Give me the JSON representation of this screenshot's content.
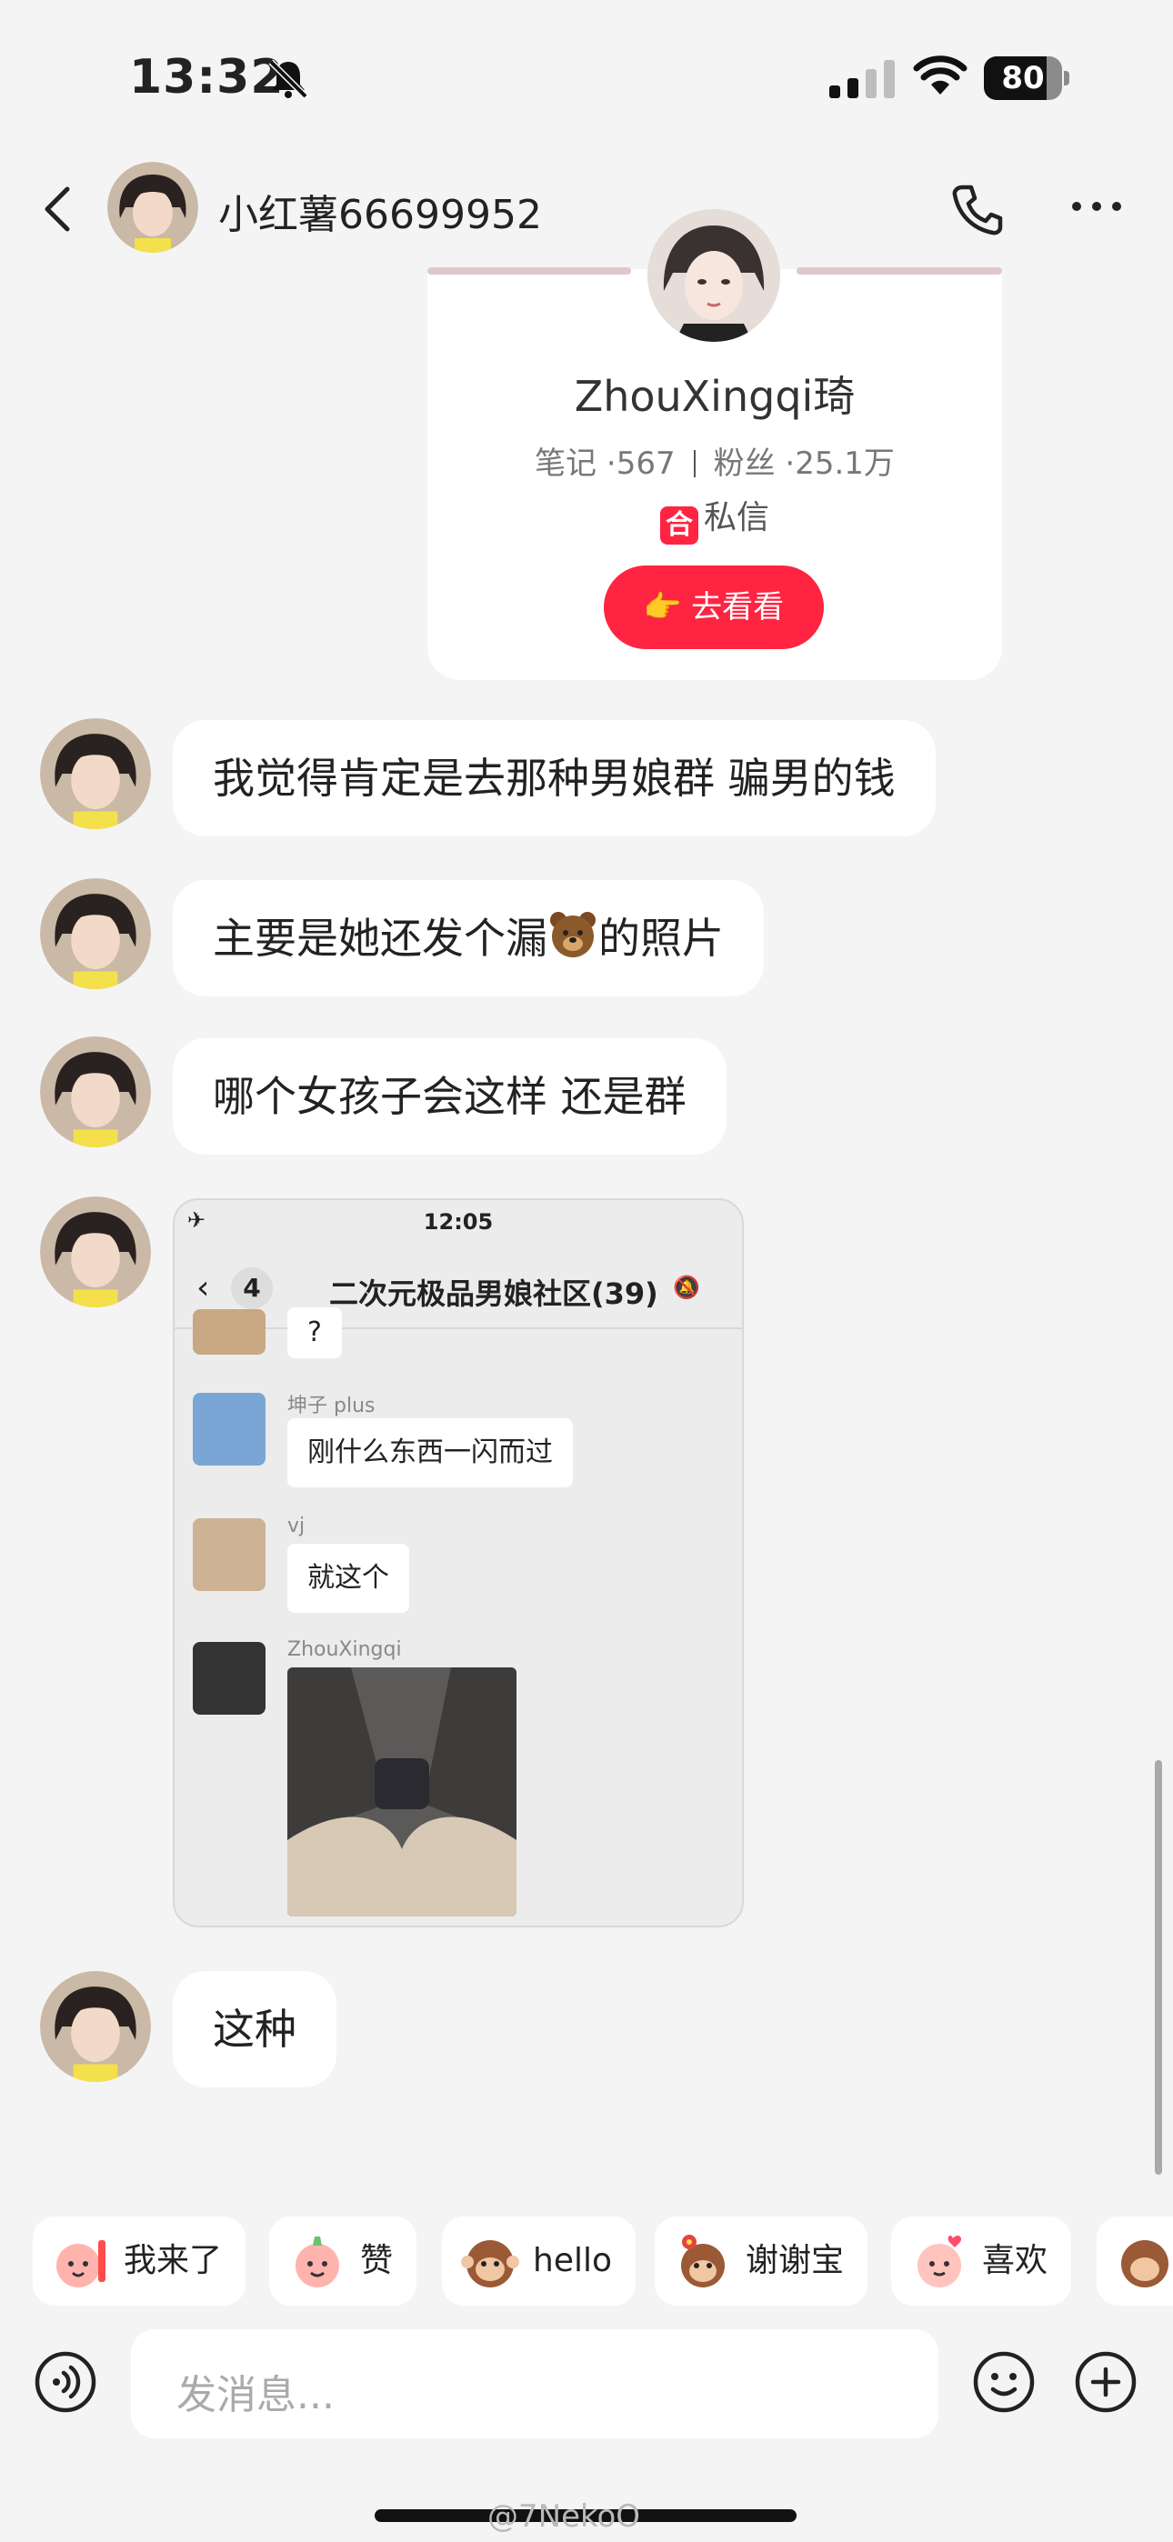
{
  "status_bar": {
    "time": "13:32",
    "battery": "80",
    "battery_fraction": 0.8
  },
  "header": {
    "title": "小红薯66699952"
  },
  "profile_card": {
    "name": "ZhouXingqi琦",
    "notes_label": "笔记",
    "notes_value": "567",
    "fans_label": "粉丝",
    "fans_value": "25.1万",
    "dm_badge": "合",
    "dm_label": "私信",
    "visit_hand": "👉",
    "visit_label": "去看看"
  },
  "messages": [
    {
      "text": "我觉得肯定是去那种男娘群 骗男的钱"
    },
    {
      "text_before": "主要是她还发个漏",
      "text_after": "的照片"
    },
    {
      "text": "哪个女孩子会这样 还是群"
    },
    {
      "text": "这种"
    }
  ],
  "screenshot": {
    "time": "12:05",
    "back_count": "4",
    "group_title": "二次元极品男娘社区(39)",
    "items": [
      {
        "name": "",
        "text": "?"
      },
      {
        "name": "坤子 plus",
        "text": "刚什么东西一闪而过"
      },
      {
        "name": "vj",
        "text": "就这个"
      },
      {
        "name": "ZhouXingqi",
        "text": ""
      }
    ]
  },
  "quick_replies": [
    {
      "label": "我来了",
      "icon": "peach-cheer-icon"
    },
    {
      "label": "赞",
      "icon": "peach-thumb-icon"
    },
    {
      "label": "hello",
      "icon": "monkey-wave-icon"
    },
    {
      "label": "谢谢宝",
      "icon": "monkey-flower-icon"
    },
    {
      "label": "喜欢",
      "icon": "peach-heart-icon"
    }
  ],
  "input": {
    "placeholder": "发消息..."
  },
  "watermark": "@7NekoO",
  "colors": {
    "accent": "#ff2442",
    "bubble": "#ffffff",
    "background": "#f4f4f4"
  }
}
